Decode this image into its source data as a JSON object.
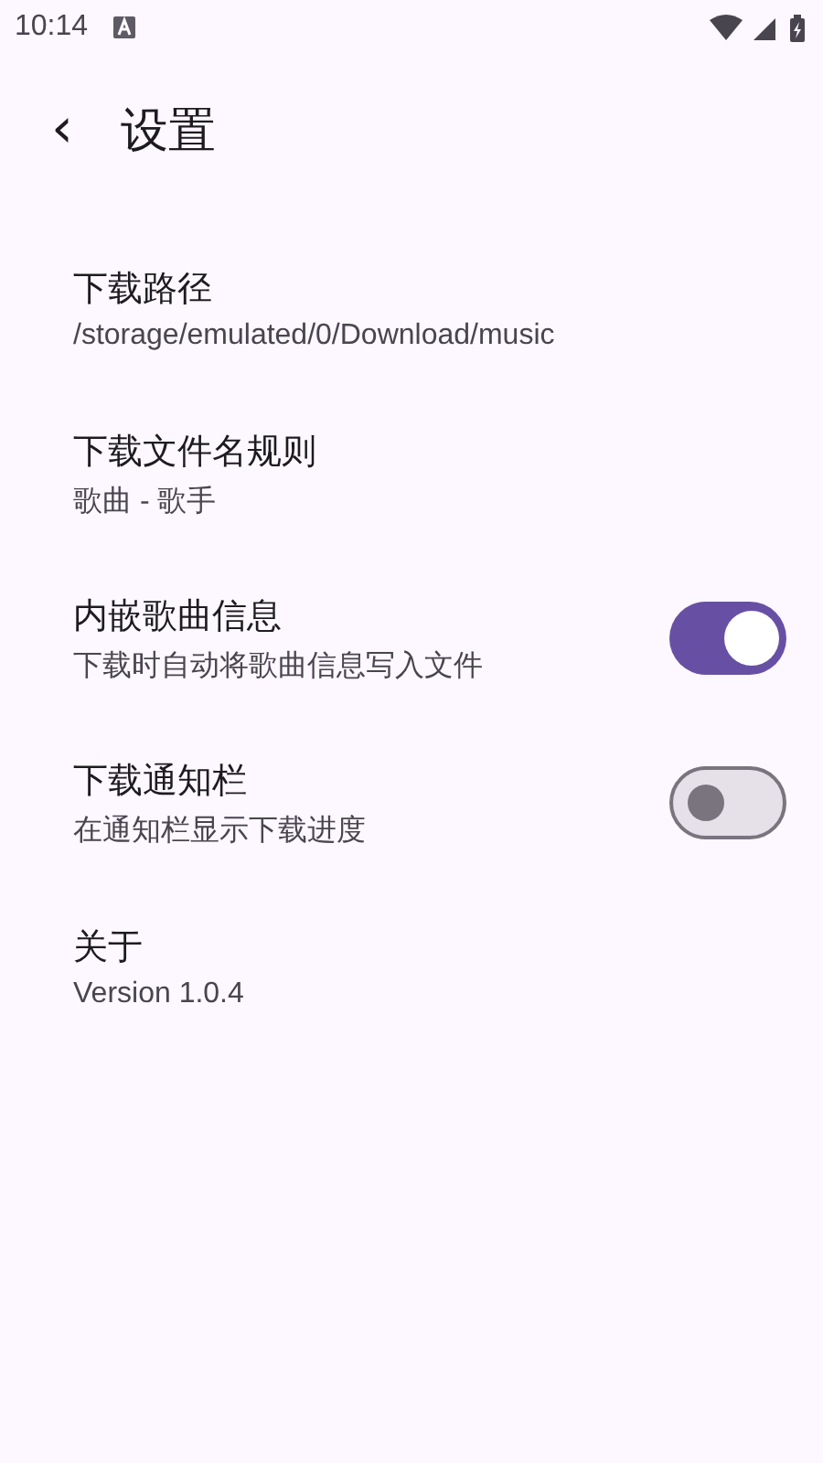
{
  "status_bar": {
    "time": "10:14"
  },
  "header": {
    "back": "‹",
    "title": "设置"
  },
  "settings": [
    {
      "kind": "text",
      "title": "下载路径",
      "subtitle": "/storage/emulated/0/Download/music"
    },
    {
      "kind": "text",
      "title": "下载文件名规则",
      "subtitle": "歌曲 - 歌手"
    },
    {
      "kind": "switch",
      "title": "内嵌歌曲信息",
      "subtitle": "下载时自动将歌曲信息写入文件",
      "on": true
    },
    {
      "kind": "switch",
      "title": "下载通知栏",
      "subtitle": "在通知栏显示下载进度",
      "on": false
    },
    {
      "kind": "text",
      "title": "关于",
      "subtitle": "Version 1.0.4"
    }
  ]
}
